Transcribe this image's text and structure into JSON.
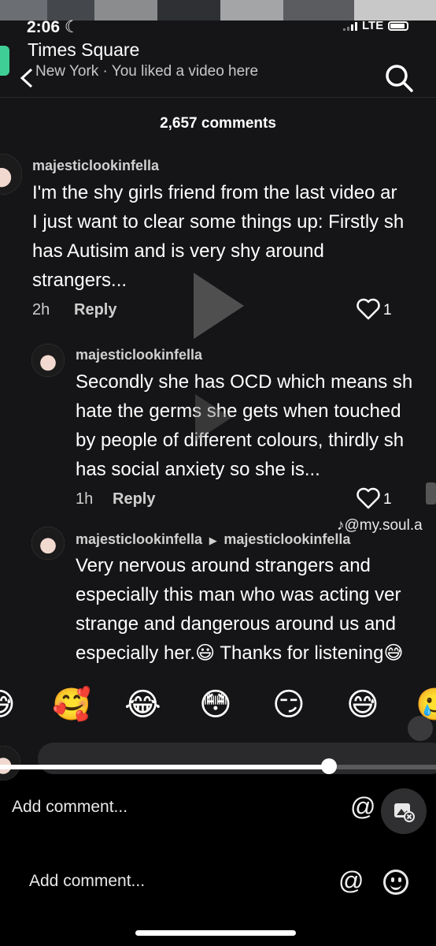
{
  "status": {
    "time": "2:06",
    "network": "LTE"
  },
  "location": {
    "title": "Times Square",
    "subtitle": "New York · You liked a video here"
  },
  "comments_count": "2,657 comments",
  "comments": [
    {
      "username": "majesticlookinfella",
      "lines": [
        "I'm the shy girls friend from the last video ar",
        "I just want to clear some things up: Firstly sh",
        "has Autisim and is very shy around",
        "strangers..."
      ],
      "time": "2h",
      "reply": "Reply",
      "likes": "1"
    },
    {
      "username": "majesticlookinfella",
      "lines": [
        "Secondly she has OCD which means sh",
        "hate the germs she gets when touched",
        "by people of different colours, thirdly sh",
        "has social anxiety so she is..."
      ],
      "time": "1h",
      "reply": "Reply",
      "likes": "1"
    },
    {
      "username": "majesticlookinfella",
      "reply_to": "majesticlookinfella",
      "lines": [
        "Very nervous around strangers and",
        "especially this man who was acting ver",
        "strange and dangerous around us and",
        "especially her.😃 Thanks for listening😅"
      ]
    }
  ],
  "watermark": "♪@my.soul.a",
  "emoji_row": [
    "😅",
    "🥰",
    "😂",
    "😳",
    "😏",
    "😅",
    "🥲"
  ],
  "composer_placeholder": "Add comment...",
  "composer2_placeholder": "Add comment...",
  "icons": {
    "mention": "@",
    "gallery": "image-icon",
    "emoji": "emoji-icon"
  }
}
